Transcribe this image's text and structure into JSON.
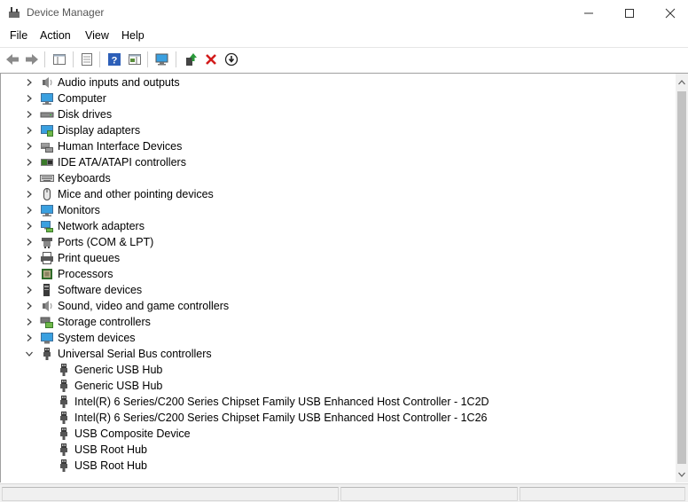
{
  "window": {
    "title": "Device Manager"
  },
  "menu": [
    "File",
    "Action",
    "View",
    "Help"
  ],
  "tree": {
    "categories": [
      {
        "label": "Audio inputs and outputs",
        "icon": "speaker-icon",
        "expanded": false
      },
      {
        "label": "Computer",
        "icon": "computer-icon",
        "expanded": false
      },
      {
        "label": "Disk drives",
        "icon": "disk-drive-icon",
        "expanded": false
      },
      {
        "label": "Display adapters",
        "icon": "display-adapter-icon",
        "expanded": false
      },
      {
        "label": "Human Interface Devices",
        "icon": "hid-icon",
        "expanded": false
      },
      {
        "label": "IDE ATA/ATAPI controllers",
        "icon": "ide-controller-icon",
        "expanded": false
      },
      {
        "label": "Keyboards",
        "icon": "keyboard-icon",
        "expanded": false
      },
      {
        "label": "Mice and other pointing devices",
        "icon": "mouse-icon",
        "expanded": false
      },
      {
        "label": "Monitors",
        "icon": "monitor-icon",
        "expanded": false
      },
      {
        "label": "Network adapters",
        "icon": "network-adapter-icon",
        "expanded": false
      },
      {
        "label": "Ports (COM & LPT)",
        "icon": "port-icon",
        "expanded": false
      },
      {
        "label": "Print queues",
        "icon": "printer-icon",
        "expanded": false
      },
      {
        "label": "Processors",
        "icon": "processor-icon",
        "expanded": false
      },
      {
        "label": "Software devices",
        "icon": "software-device-icon",
        "expanded": false
      },
      {
        "label": "Sound, video and game controllers",
        "icon": "speaker-icon",
        "expanded": false
      },
      {
        "label": "Storage controllers",
        "icon": "storage-controller-icon",
        "expanded": false
      },
      {
        "label": "System devices",
        "icon": "system-device-icon",
        "expanded": false
      },
      {
        "label": "Universal Serial Bus controllers",
        "icon": "usb-icon",
        "expanded": true
      }
    ],
    "usb_children": [
      "Generic USB Hub",
      "Generic USB Hub",
      "Intel(R) 6 Series/C200 Series Chipset Family USB Enhanced Host Controller - 1C2D",
      "Intel(R) 6 Series/C200 Series Chipset Family USB Enhanced Host Controller - 1C26",
      "USB Composite Device",
      "USB Root Hub",
      "USB Root Hub"
    ]
  },
  "toolbar": {
    "icons": [
      "back-icon",
      "forward-icon",
      "properties-pane-icon",
      "properties-icon",
      "help-icon",
      "action-pane-icon",
      "scan-hardware-icon",
      "update-driver-icon",
      "uninstall-icon",
      "disable-device-icon"
    ]
  },
  "colors": {
    "accent_blue": "#1e6fd9",
    "uninstall_red": "#d21b1b",
    "update_green": "#2a9a3a"
  }
}
